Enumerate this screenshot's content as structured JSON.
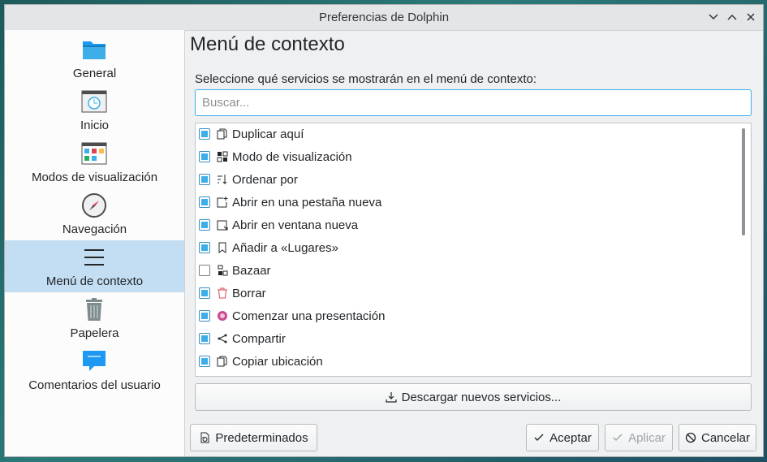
{
  "window": {
    "title": "Preferencias de Dolphin"
  },
  "sidebar": {
    "items": [
      {
        "label": "General",
        "icon": "folder-icon"
      },
      {
        "label": "Inicio",
        "icon": "startup-window-icon"
      },
      {
        "label": "Modos de visualización",
        "icon": "view-modes-icon"
      },
      {
        "label": "Navegación",
        "icon": "compass-icon"
      },
      {
        "label": "Menú de contexto",
        "icon": "hamburger-menu-icon",
        "active": true
      },
      {
        "label": "Papelera",
        "icon": "trash-icon"
      },
      {
        "label": "Comentarios del usuario",
        "icon": "speech-bubble-icon"
      }
    ]
  },
  "main": {
    "title": "Menú de contexto",
    "description": "Seleccione qué servicios se mostrarán en el menú de contexto:",
    "search_placeholder": "Buscar...",
    "search_value": "",
    "services": [
      {
        "label": "Duplicar aquí",
        "checked": true,
        "icon": "duplicate-icon"
      },
      {
        "label": "Modo de visualización",
        "checked": true,
        "icon": "view-grid-icon"
      },
      {
        "label": "Ordenar por",
        "checked": true,
        "icon": "sort-icon"
      },
      {
        "label": "Abrir en una pestaña nueva",
        "checked": true,
        "icon": "new-tab-icon"
      },
      {
        "label": "Abrir en ventana nueva",
        "checked": true,
        "icon": "new-window-icon"
      },
      {
        "label": "Añadir a «Lugares»",
        "checked": true,
        "icon": "bookmark-icon"
      },
      {
        "label": "Bazaar",
        "checked": false,
        "icon": "bazaar-icon"
      },
      {
        "label": "Borrar",
        "checked": true,
        "icon": "delete-icon"
      },
      {
        "label": "Comenzar una presentación",
        "checked": true,
        "icon": "presentation-icon"
      },
      {
        "label": "Compartir",
        "checked": true,
        "icon": "share-icon"
      },
      {
        "label": "Copiar ubicación",
        "checked": true,
        "icon": "copy-location-icon"
      }
    ],
    "download_label": "Descargar nuevos servicios..."
  },
  "footer": {
    "defaults_label": "Predeterminados",
    "ok_label": "Aceptar",
    "apply_label": "Aplicar",
    "cancel_label": "Cancelar"
  },
  "colors": {
    "accent": "#3daee9",
    "selection": "#c3ddf2",
    "delete_red": "#da4453"
  }
}
